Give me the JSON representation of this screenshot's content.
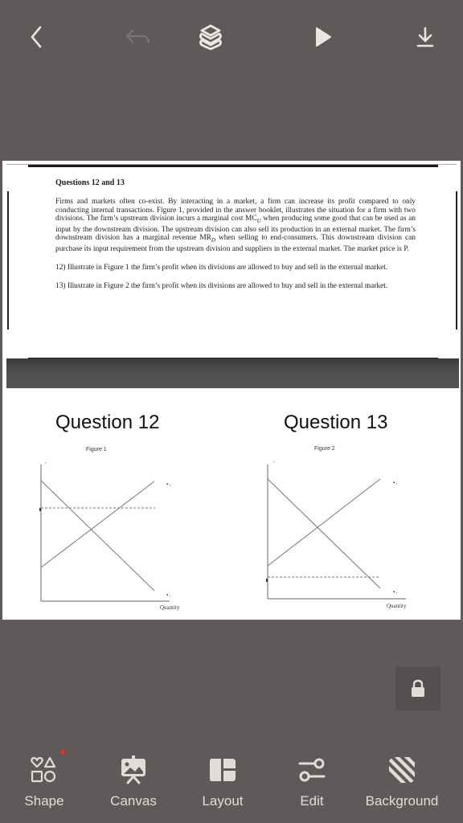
{
  "toolbar": {
    "back_icon": "chevron-left-icon",
    "undo_icon": "undo-arrow-icon",
    "layers_icon": "layers-icon",
    "play_icon": "play-icon",
    "download_icon": "download-icon",
    "undo_disabled": true
  },
  "document": {
    "heading": "Questions 12 and 13",
    "paragraph": "Firms and markets often co-exist. By interacting in a market, a firm can increase its profit compared to only conducting internal transactions. Figure 1, provided in the answer booklet, illustrates the situation for a firm with two divisions. The firm’s upstream division incurs a marginal cost MC",
    "paragraph_sub_u": "U",
    "paragraph_mid": " when producing some good that can be used as an input by the downstream division. The upstream division can also sell its production in an external market. The firm’s downstream division has a marginal revenue MR",
    "paragraph_sub_d": "D",
    "paragraph_end": " when selling to end-consumers. This downstream division can purchase its input requirement from the upstream division and suppliers in the external market. The market price is P.",
    "questions": [
      "12) Illustrate in Figure 1 the firm’s profit when its divisions are allowed to buy and sell in the external market.",
      "13) Illustrate in Figure 2 the firm’s profit when its divisions are allowed to buy and sell in the external market."
    ]
  },
  "figures": [
    {
      "title": "Question 12",
      "figure_label": "Figure 1",
      "x_axis_label": "Quantity",
      "price_line": "above intersection",
      "price_level": 0.72
    },
    {
      "title": "Question 13",
      "figure_label": "Figure 2",
      "x_axis_label": "Quantity",
      "price_line": "below intersection",
      "price_level": 0.15
    }
  ],
  "lock_button": {
    "icon": "lock-icon"
  },
  "bottom_nav": [
    {
      "label": "Shape",
      "icon": "shapes-icon",
      "has_badge": true
    },
    {
      "label": "Canvas",
      "icon": "canvas-easel-icon"
    },
    {
      "label": "Layout",
      "icon": "layout-icon"
    },
    {
      "label": "Edit",
      "icon": "sliders-icon"
    },
    {
      "label": "Background",
      "icon": "background-stripes-icon"
    }
  ],
  "colors": {
    "app_background": "#5f5a59",
    "icon_color": "#e2dcd8",
    "badge": "#e8312e"
  }
}
